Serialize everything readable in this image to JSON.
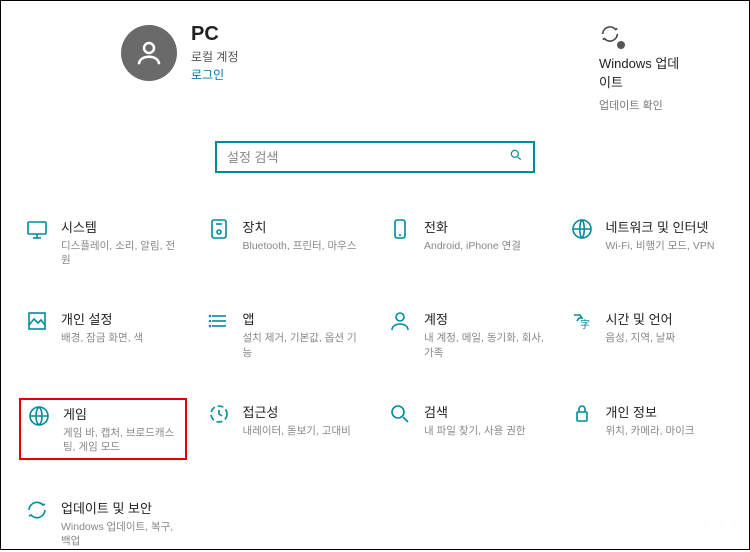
{
  "account": {
    "name": "PC",
    "type": "로컬 계정",
    "login": "로그인"
  },
  "update": {
    "title": "Windows 업데이트",
    "sub": "업데이트 확인"
  },
  "search": {
    "placeholder": "설정 검색"
  },
  "tiles": [
    {
      "title": "시스템",
      "desc": "디스플레이, 소리, 알림, 전원"
    },
    {
      "title": "장치",
      "desc": "Bluetooth, 프린터, 마우스"
    },
    {
      "title": "전화",
      "desc": "Android, iPhone 연결"
    },
    {
      "title": "네트워크 및 인터넷",
      "desc": "Wi-Fi, 비행기 모드, VPN"
    },
    {
      "title": "개인 설정",
      "desc": "배경, 잠금 화면, 색"
    },
    {
      "title": "앱",
      "desc": "설치 제거, 기본값, 옵션 기능"
    },
    {
      "title": "계정",
      "desc": "내 계정, 메일, 동기화, 회사, 가족"
    },
    {
      "title": "시간 및 언어",
      "desc": "음성, 지역, 날짜"
    },
    {
      "title": "게임",
      "desc": "게임 바, 캡처, 브로드캐스팅, 게임 모드"
    },
    {
      "title": "접근성",
      "desc": "내레이터, 돋보기, 고대비"
    },
    {
      "title": "검색",
      "desc": "내 파일 찾기, 사용 권한"
    },
    {
      "title": "개인 정보",
      "desc": "위치, 카메라, 마이크"
    },
    {
      "title": "업데이트 및 보안",
      "desc": "Windows 업데이트, 복구, 백업"
    }
  ],
  "watermark": "인포탑",
  "highlight_index": 8
}
